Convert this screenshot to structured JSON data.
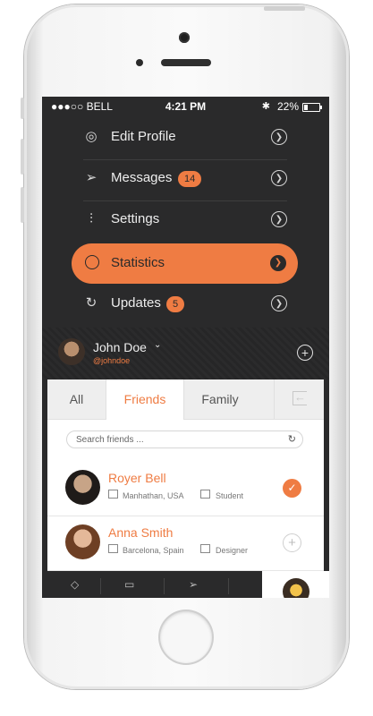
{
  "status_bar": {
    "carrier": "●●●○○ BELL",
    "time": "4:21 PM",
    "battery": "22%"
  },
  "menu": {
    "items": [
      {
        "label": "Edit Profile",
        "icon": "user-icon"
      },
      {
        "label": "Messages",
        "icon": "paper-plane-icon",
        "badge": "14"
      },
      {
        "label": "Settings",
        "icon": "sliders-icon"
      },
      {
        "label": "Statistics",
        "icon": "pie-chart-icon",
        "active": true
      },
      {
        "label": "Updates",
        "icon": "refresh-icon",
        "badge": "5"
      }
    ]
  },
  "user": {
    "name": "John Doe",
    "handle": "@johndoe"
  },
  "tabs": [
    {
      "label": "All"
    },
    {
      "label": "Friends",
      "active": true
    },
    {
      "label": "Family"
    }
  ],
  "search": {
    "placeholder": "Search friends ..."
  },
  "friends": [
    {
      "name": "Royer Bell",
      "location": "Manhathan, USA",
      "role": "Student",
      "added": true
    },
    {
      "name": "Anna Smith",
      "location": "Barcelona, Spain",
      "role": "Designer",
      "added": false
    }
  ],
  "colors": {
    "accent": "#ef7c43",
    "dark": "#2a2a2b",
    "panel": "#ffffff"
  }
}
